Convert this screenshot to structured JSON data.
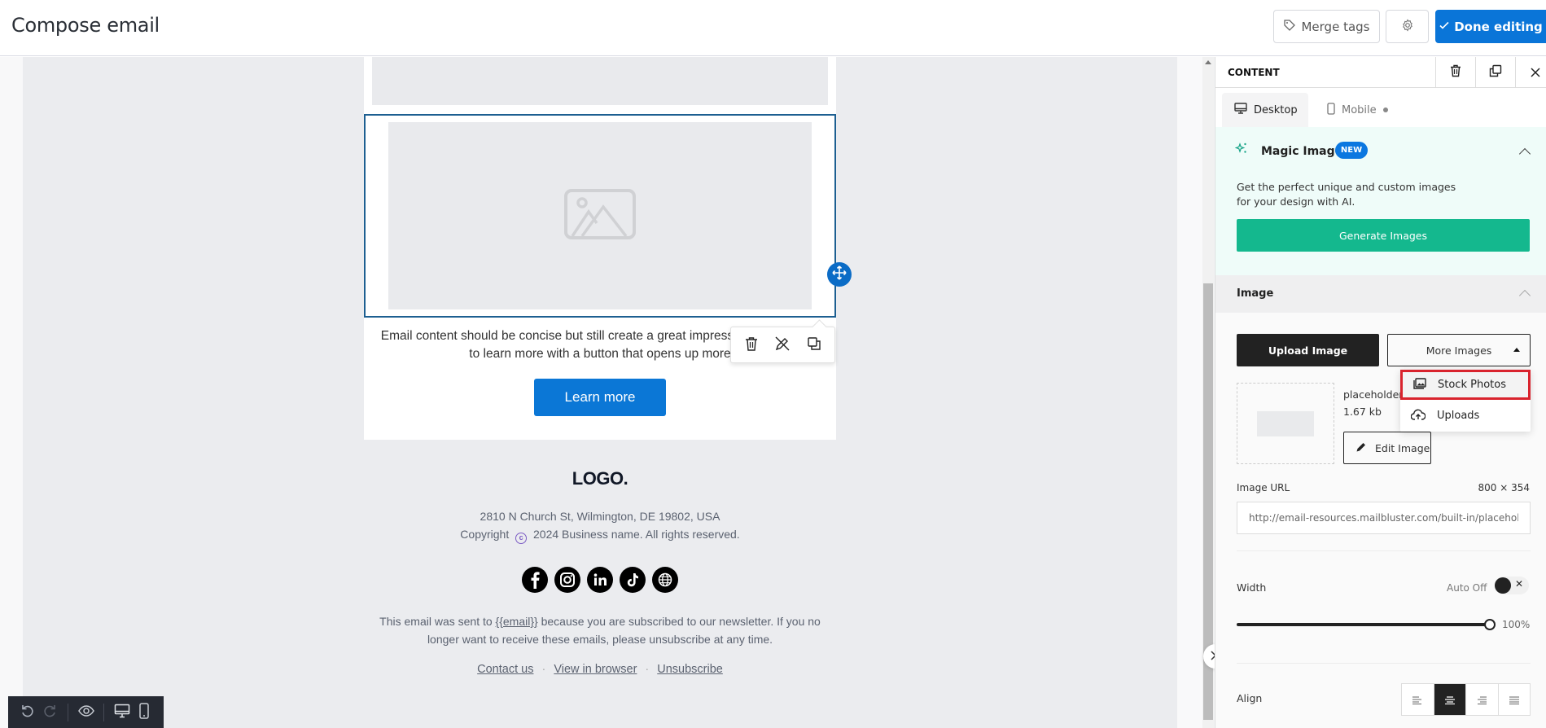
{
  "header": {
    "title": "Compose email",
    "merge_tags_label": "Merge tags",
    "settings_icon": "gear-icon",
    "done_label": "Done editing"
  },
  "canvas": {
    "body_text": "Email content should be concise but still create a great impression. Encourage your recipients to learn more with a button that opens up more",
    "body_text_visible": "Email content should be concise but still create a great impress your recipients to learn more with a button that opens up more",
    "button_label": "Learn more",
    "block_toolbar": [
      "delete-icon",
      "remove-link-icon",
      "duplicate-icon"
    ],
    "footer": {
      "logo": "LOGO.",
      "address": "2810 N Church St, Wilmington, DE 19802, USA",
      "copyright_prefix": "Copyright",
      "copyright_symbol": "c",
      "copyright_suffix": "2024 Business name. All rights reserved.",
      "socials": [
        "facebook",
        "instagram",
        "linkedin",
        "tiktok",
        "website"
      ],
      "legal_prefix": "This email was sent to ",
      "legal_tag": "{{email}}",
      "legal_suffix": " because you are subscribed to our newsletter. If you no longer want to receive these emails, please unsubscribe at any time.",
      "links": [
        "Contact us",
        "View in browser",
        "Unsubscribe"
      ],
      "link_separator": "·"
    }
  },
  "bottom_toolbar": [
    "undo",
    "redo",
    "preview",
    "desktop-view",
    "mobile-view"
  ],
  "panel": {
    "title": "CONTENT",
    "tabs": [
      {
        "label": "Desktop",
        "active": true
      },
      {
        "label": "Mobile",
        "active": false
      }
    ],
    "magic": {
      "title": "Magic Image",
      "badge": "NEW",
      "description_line1": "Get the perfect unique and custom images",
      "description_line2": "for your design with AI.",
      "button": "Generate Images"
    },
    "image_section": {
      "title": "Image",
      "upload_label": "Upload Image",
      "more_label": "More Images",
      "dropdown": [
        {
          "label": "Stock Photos",
          "icon": "image-icon",
          "highlighted": true
        },
        {
          "label": "Uploads",
          "icon": "cloud-upload-icon",
          "highlighted": false
        }
      ],
      "file_name": "placeholder",
      "file_size": "1.67 kb",
      "edit_label": "Edit Image",
      "url_label": "Image URL",
      "dimensions": "800 × 354",
      "url_value": "http://email-resources.mailbluster.com/built-in/placeholder"
    },
    "width": {
      "label": "Width",
      "auto_label": "Auto Off",
      "toggle_on": false,
      "value_percent": 100,
      "value_text": "100%"
    },
    "align": {
      "label": "Align",
      "options": [
        "left",
        "center",
        "right",
        "justify"
      ],
      "selected": "center"
    }
  },
  "colors": {
    "primary": "#0a75d8",
    "magic_green": "#14b88e",
    "highlight_red": "#d9232d",
    "selection_border": "#1d5f91"
  }
}
